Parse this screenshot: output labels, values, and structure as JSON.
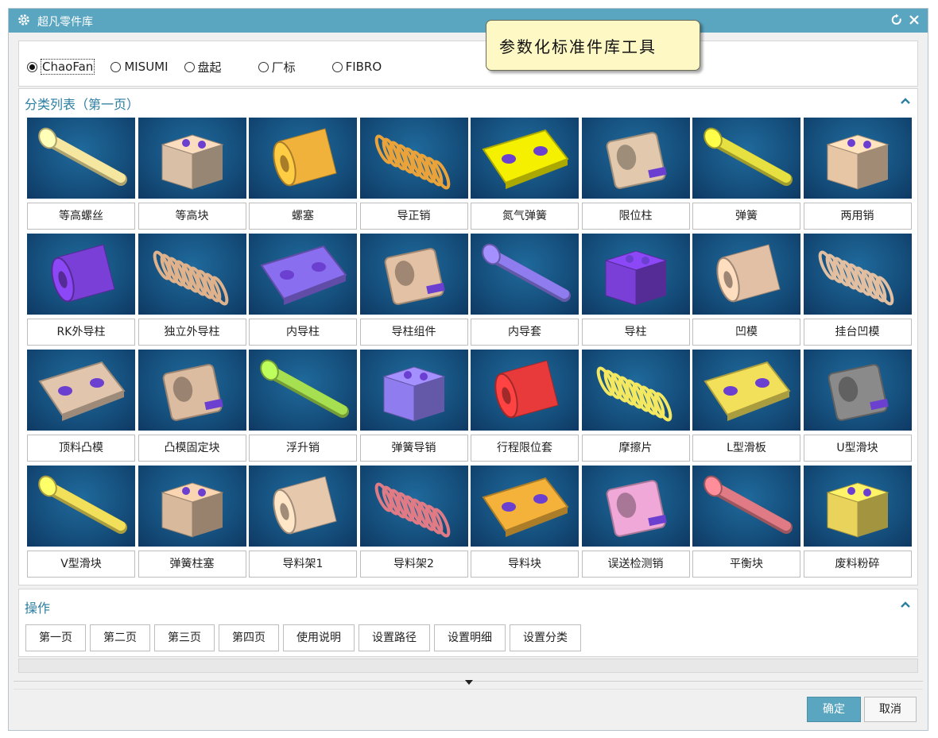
{
  "window": {
    "title": "超凡零件库"
  },
  "tooltip": {
    "text": "参数化标准件库工具"
  },
  "radio_options": [
    {
      "label": "ChaoFan",
      "selected": true
    },
    {
      "label": "MISUMI",
      "selected": false
    },
    {
      "label": "盘起",
      "selected": false
    },
    {
      "label": "厂标",
      "selected": false
    },
    {
      "label": "FIBRO",
      "selected": false
    }
  ],
  "category": {
    "title": "分类列表（第一页）",
    "items": [
      {
        "label": "等高螺丝",
        "icon": "shoulder-screw-icon",
        "color": "#f5e7a0"
      },
      {
        "label": "等高块",
        "icon": "parallel-block-icon",
        "color": "#d9bfa6"
      },
      {
        "label": "螺塞",
        "icon": "screw-plug-icon",
        "color": "#f0b23a"
      },
      {
        "label": "导正销",
        "icon": "pilot-pin-icon",
        "color": "#e9a33a"
      },
      {
        "label": "氮气弹簧",
        "icon": "gas-spring-icon",
        "color": "#f4f000"
      },
      {
        "label": "限位柱",
        "icon": "stop-post-icon",
        "color": "#e2c9ad"
      },
      {
        "label": "弹簧",
        "icon": "spring-icon",
        "color": "#e6e040"
      },
      {
        "label": "两用销",
        "icon": "dual-pin-icon",
        "color": "#e7c6a6"
      },
      {
        "label": "RK外导柱",
        "icon": "rk-guide-post-icon",
        "color": "#7a3fd6"
      },
      {
        "label": "独立外导柱",
        "icon": "independent-guide-post-icon",
        "color": "#dfb28c"
      },
      {
        "label": "内导柱",
        "icon": "inner-guide-post-icon",
        "color": "#8a6ef0"
      },
      {
        "label": "导柱组件",
        "icon": "guide-post-assembly-icon",
        "color": "#e3c1a4"
      },
      {
        "label": "内导套",
        "icon": "inner-guide-bush-icon",
        "color": "#8f7df0"
      },
      {
        "label": "导柱",
        "icon": "guide-post-icon",
        "color": "#7a3fd6"
      },
      {
        "label": "凹模",
        "icon": "die-icon",
        "color": "#e2c0a6"
      },
      {
        "label": "挂台凹模",
        "icon": "shoulder-die-icon",
        "color": "#e3bfa2"
      },
      {
        "label": "顶料凸模",
        "icon": "ejector-punch-icon",
        "color": "#e2c5ad"
      },
      {
        "label": "凸模固定块",
        "icon": "punch-retainer-icon",
        "color": "#dcbca1"
      },
      {
        "label": "浮升销",
        "icon": "lifter-pin-icon",
        "color": "#a6e050"
      },
      {
        "label": "弹簧导销",
        "icon": "spring-guide-pin-icon",
        "color": "#8f7df0"
      },
      {
        "label": "行程限位套",
        "icon": "stroke-limit-sleeve-icon",
        "color": "#e83a3a"
      },
      {
        "label": "摩擦片",
        "icon": "friction-plate-icon",
        "color": "#f4e860"
      },
      {
        "label": "L型滑板",
        "icon": "l-slide-plate-icon",
        "color": "#f3e05a"
      },
      {
        "label": "U型滑块",
        "icon": "u-slider-icon",
        "color": "#8a8a8a"
      },
      {
        "label": "V型滑块",
        "icon": "v-slider-icon",
        "color": "#f3e05a"
      },
      {
        "label": "弹簧柱塞",
        "icon": "spring-plunger-icon",
        "color": "#d9b99b"
      },
      {
        "label": "导料架1",
        "icon": "guide-rack-1-icon",
        "color": "#e6c8ad"
      },
      {
        "label": "导料架2",
        "icon": "guide-rack-2-icon",
        "color": "#e07b86"
      },
      {
        "label": "导料块",
        "icon": "guide-block-icon",
        "color": "#f4b23a"
      },
      {
        "label": "误送检测销",
        "icon": "misfeed-pin-icon",
        "color": "#f0a8d8"
      },
      {
        "label": "平衡块",
        "icon": "balance-block-icon",
        "color": "#e07b86"
      },
      {
        "label": "废料粉碎",
        "icon": "scrap-crusher-icon",
        "color": "#e9d35a"
      }
    ]
  },
  "operations": {
    "title": "操作",
    "buttons": [
      "第一页",
      "第二页",
      "第三页",
      "第四页",
      "使用说明",
      "设置路径",
      "设置明细",
      "设置分类"
    ]
  },
  "footer": {
    "ok_label": "确定",
    "cancel_label": "取消"
  },
  "colors": {
    "title_bar": "#5aa6c1",
    "accent_text": "#2c7ea0",
    "thumb_bg": "#16517f"
  }
}
